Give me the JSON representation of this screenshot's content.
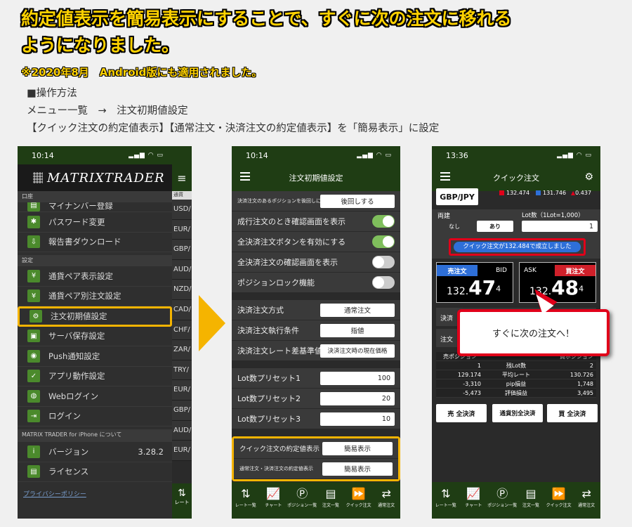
{
  "headline": {
    "line1": "約定値表示を簡易表示にすることで、すぐに次の注文に移れる",
    "line2": "ようになりました。"
  },
  "note": "※2020年8月　Android版にも適用されました。",
  "instructions": {
    "title": "■操作方法",
    "line1": "メニュー一覧　→　注文初期値設定",
    "line2": "【クイック注文の約定値表示】【通常注文・決済注文の約定値表示】を「簡易表示」に設定"
  },
  "phone1": {
    "time": "10:14",
    "logo": "MATRIXTRADER",
    "section_account": "口座",
    "item_top": "マイナンバー登録",
    "items_account": [
      "パスワード変更",
      "報告書ダウンロード"
    ],
    "section_settings": "設定",
    "items_settings": [
      "通貨ペア表示設定",
      "通貨ペア別注文設定",
      "注文初期値設定",
      "サーバ保存設定",
      "Push通知設定",
      "アプリ動作設定",
      "Webログイン",
      "ログイン"
    ],
    "section_about": "MATRIX TRADER for iPhone について",
    "version_label": "バージョン",
    "version_value": "3.28.2",
    "license": "ライセンス",
    "privacy": "プライバシーポリシー",
    "right_sub": "通貨",
    "right_pairs": [
      "USD/",
      "EUR/",
      "GBP/",
      "AUD/",
      "NZD/",
      "CAD/",
      "CHF/",
      "ZAR/",
      "TRY/",
      "EUR/",
      "GBP/",
      "AUD/",
      "EUR/"
    ],
    "right_foot": "レート"
  },
  "phone2": {
    "time": "10:14",
    "title": "注文初期値設定",
    "row0": {
      "label": "決済注文のあるポジションを後回しにする",
      "value": "後回しする"
    },
    "toggles": [
      {
        "label": "成行注文のとき確認画面を表示",
        "on": true
      },
      {
        "label": "全決済注文ボタンを有効にする",
        "on": true
      },
      {
        "label": "全決済注文の確認画面を表示",
        "on": false
      },
      {
        "label": "ポジションロック機能",
        "on": false
      }
    ],
    "fields": [
      {
        "label": "決済注文方式",
        "value": "通常注文"
      },
      {
        "label": "決済注文執行条件",
        "value": "指値"
      },
      {
        "label": "決済注文レート差基準値",
        "value": "決済注文時の現在価格"
      }
    ],
    "lots": [
      {
        "label": "Lot数プリセット1",
        "value": "100"
      },
      {
        "label": "Lot数プリセット2",
        "value": "20"
      },
      {
        "label": "Lot数プリセット3",
        "value": "10"
      }
    ],
    "highlight": [
      {
        "label": "クイック注文の約定値表示",
        "value": "簡易表示"
      },
      {
        "label": "通常注文・決済注文の約定値表示",
        "value": "簡易表示"
      }
    ]
  },
  "nav": [
    "レート一覧",
    "チャート",
    "ポジション一覧",
    "注文一覧",
    "クイック注文",
    "通常注文"
  ],
  "phone3": {
    "time": "13:36",
    "title": "クイック注文",
    "pair": "GBP/JPY",
    "high": "132.474",
    "low": "131.746",
    "change": "0.437",
    "ryodate": "両建",
    "nashi": "なし",
    "ari": "あり",
    "lot_label": "Lot数（1Lot=1,000）",
    "lot_value": "1",
    "toast": "クイック注文が132.484で成立しました",
    "sell_label": "売注文",
    "bid": "BID",
    "sell_small": "132.",
    "sell_big": "47",
    "sell_sup": "4",
    "ask": "ASK",
    "buy_label": "買注文",
    "buy_small": "132.",
    "buy_big": "48",
    "buy_sup": "4",
    "partial1": "決済",
    "partial2": "注文",
    "pos_header": [
      "売ポジション",
      "",
      "買ポジション"
    ],
    "rows": [
      [
        "1",
        "残Lot数",
        "2"
      ],
      [
        "129.174",
        "平均レート",
        "130.726"
      ],
      [
        "-3,310",
        "pip損益",
        "1,748"
      ],
      [
        "-5,473",
        "評価損益",
        "3,495"
      ]
    ],
    "btns": [
      "売 全決済",
      "通貨別全決済",
      "買 全決済"
    ]
  },
  "callout": "すぐに次の注文へ！",
  "colors": {
    "accent": "#ffd200",
    "highlight": "#f5b400",
    "alert": "#e0001a",
    "appbar": "#1f3d14"
  }
}
